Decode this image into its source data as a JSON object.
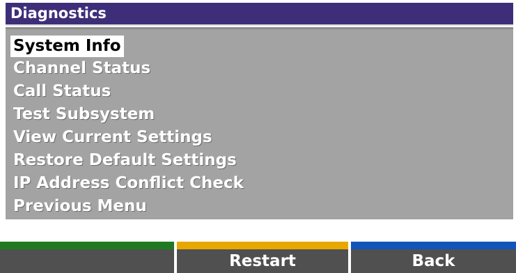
{
  "title": "Diagnostics",
  "menu": {
    "items": [
      "System Info",
      "Channel Status",
      "Call Status",
      "Test Subsystem",
      "View Current Settings",
      "Restore Default Settings",
      "IP Address Conflict Check",
      "Previous Menu"
    ],
    "selected_index": 0
  },
  "softkeys": [
    {
      "label": "",
      "color": "#1f7a1f"
    },
    {
      "label": "Restart",
      "color": "#e8a800"
    },
    {
      "label": "Back",
      "color": "#1255b8"
    }
  ],
  "colors": {
    "title_bar": "#3e2e79",
    "menu_background": "#a3a3a3",
    "softkey_background": "#505050"
  }
}
